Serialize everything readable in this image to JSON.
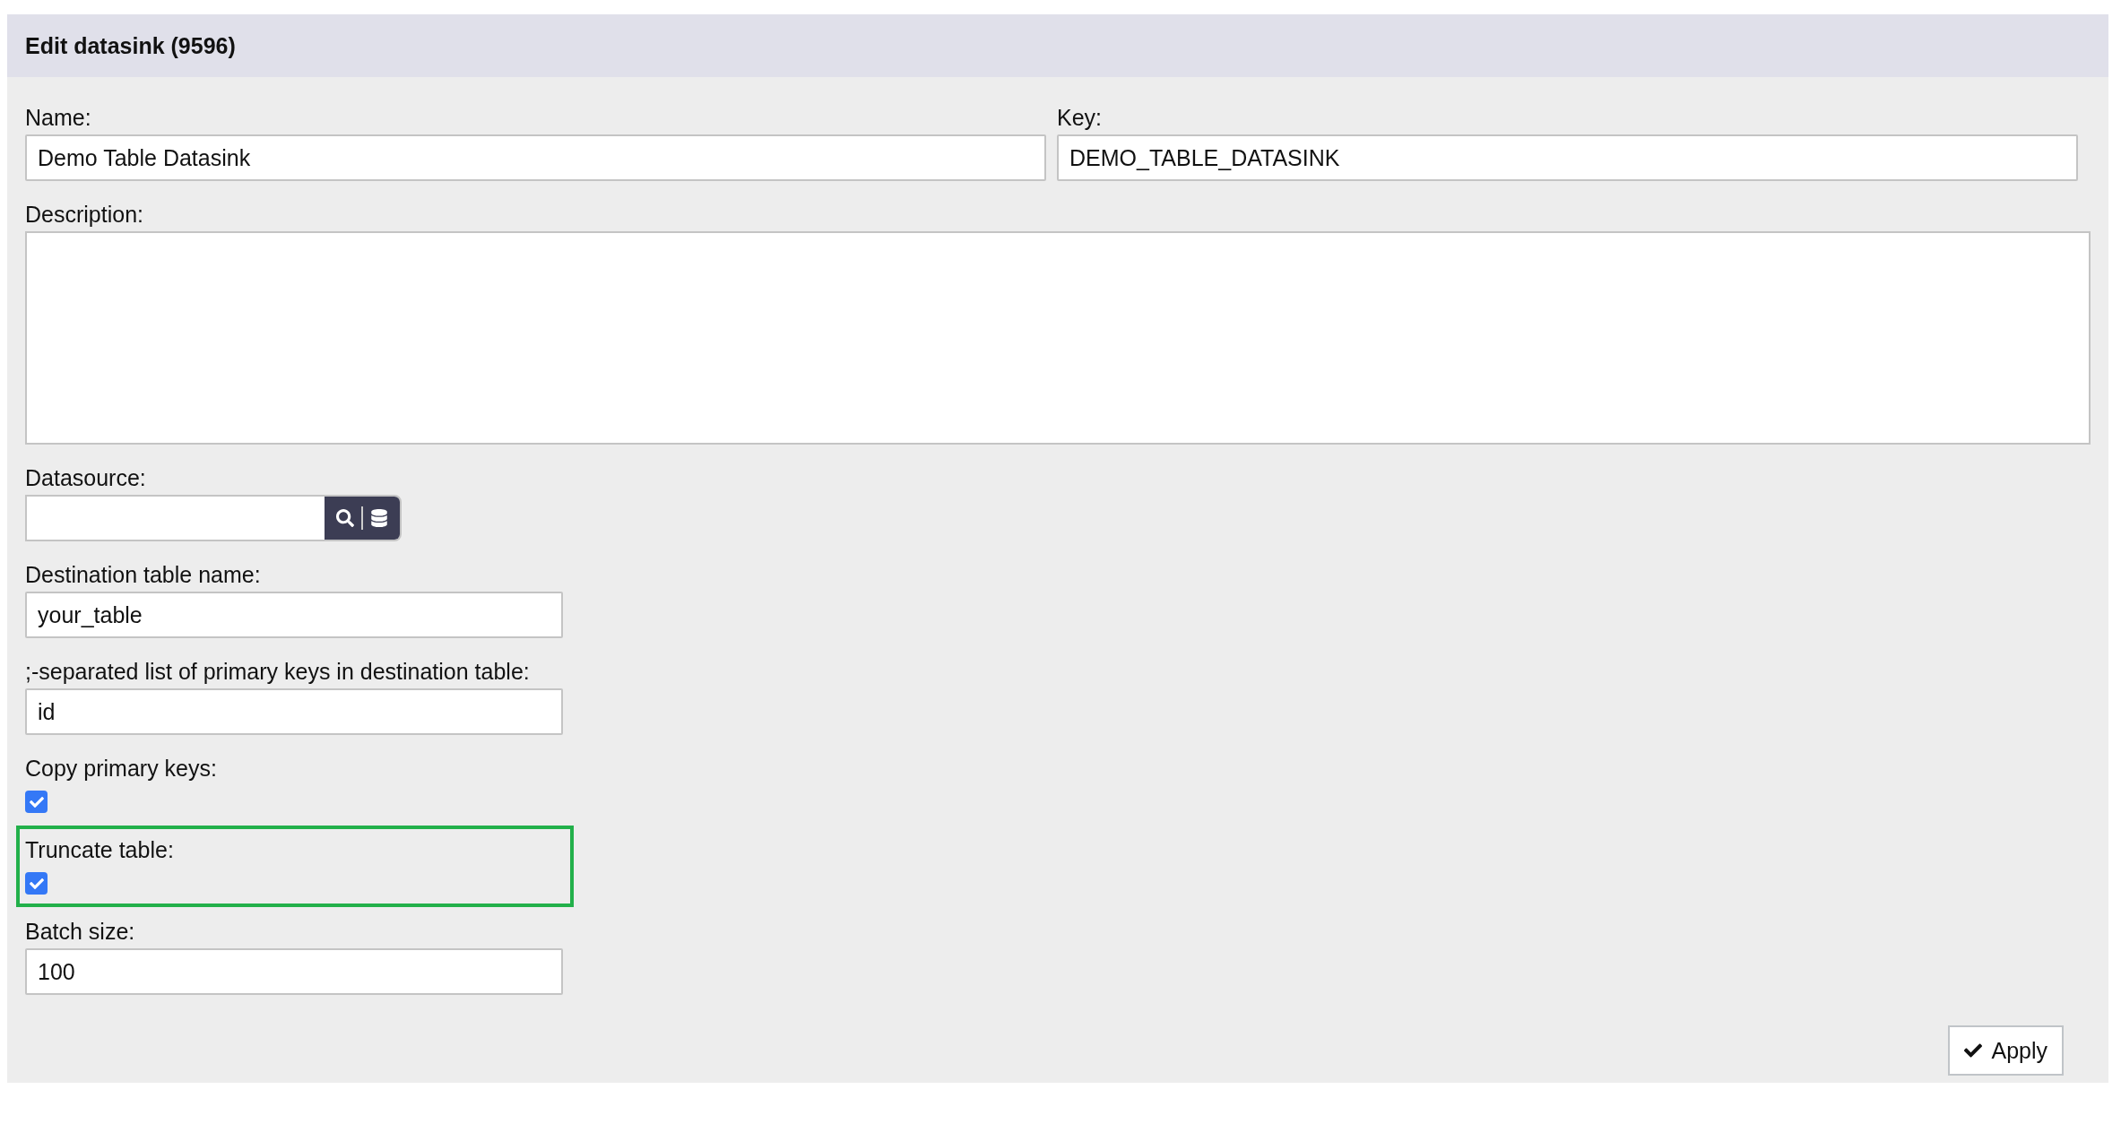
{
  "header": {
    "title": "Edit datasink (9596)"
  },
  "rows": [
    [
      {
        "kind": "text",
        "label": "Name:",
        "value": "Demo Table Datasink",
        "highlighted": false
      },
      {
        "kind": "text",
        "label": "Key:",
        "value": "DEMO_TABLE_DATASINK",
        "highlighted": false
      }
    ],
    [
      {
        "kind": "textarea",
        "label": "Description:",
        "highlighted": false
      }
    ],
    [
      {
        "kind": "lookup",
        "label": "Datasource:",
        "highlighted": false
      }
    ],
    [
      {
        "kind": "short",
        "label": "Destination table name:",
        "value": "your_table",
        "highlighted": false
      }
    ],
    [
      {
        "kind": "short",
        "label": ";-separated list of primary keys in destination table:",
        "value": "id",
        "highlighted": false
      }
    ],
    [
      {
        "kind": "checkbox",
        "label": "Copy primary keys:",
        "checked": true,
        "highlighted": false
      }
    ],
    [
      {
        "kind": "checkbox",
        "label": "Truncate table:",
        "checked": true,
        "highlighted": true
      }
    ],
    [
      {
        "kind": "short",
        "label": "Batch size:",
        "value": "100",
        "highlighted": false
      }
    ]
  ],
  "apply_button": {
    "label": "Apply"
  }
}
